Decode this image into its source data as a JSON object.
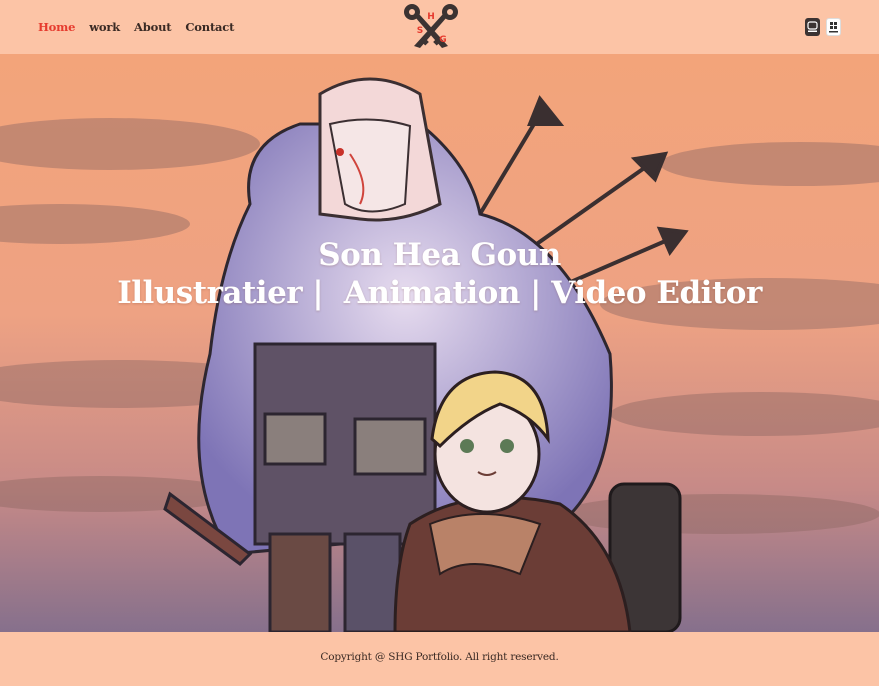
{
  "nav": {
    "items": [
      {
        "label": "Home",
        "active": true
      },
      {
        "label": "work",
        "active": false
      },
      {
        "label": "About",
        "active": false
      },
      {
        "label": "Contact",
        "active": false
      }
    ]
  },
  "logo": {
    "letters": [
      "H",
      "S",
      "G"
    ],
    "icon": "crossed-keys-logo"
  },
  "social": {
    "icons": [
      "blog-icon",
      "kakao-qr-icon"
    ]
  },
  "hero": {
    "name": "Son Hea Goun",
    "roles": "Illustratier |  Animation | Video Editor",
    "image": "illustration-two-characters-fur-cloak-arrows"
  },
  "footer": {
    "copyright": "Copyright @ SHG Portfolio. All right reserved."
  },
  "colors": {
    "header_bg": "#fcc4a6",
    "nav_active": "#e63b2e",
    "nav_text": "#3a2a24",
    "logo_dark": "#3b3332",
    "logo_red": "#e63b2e"
  }
}
